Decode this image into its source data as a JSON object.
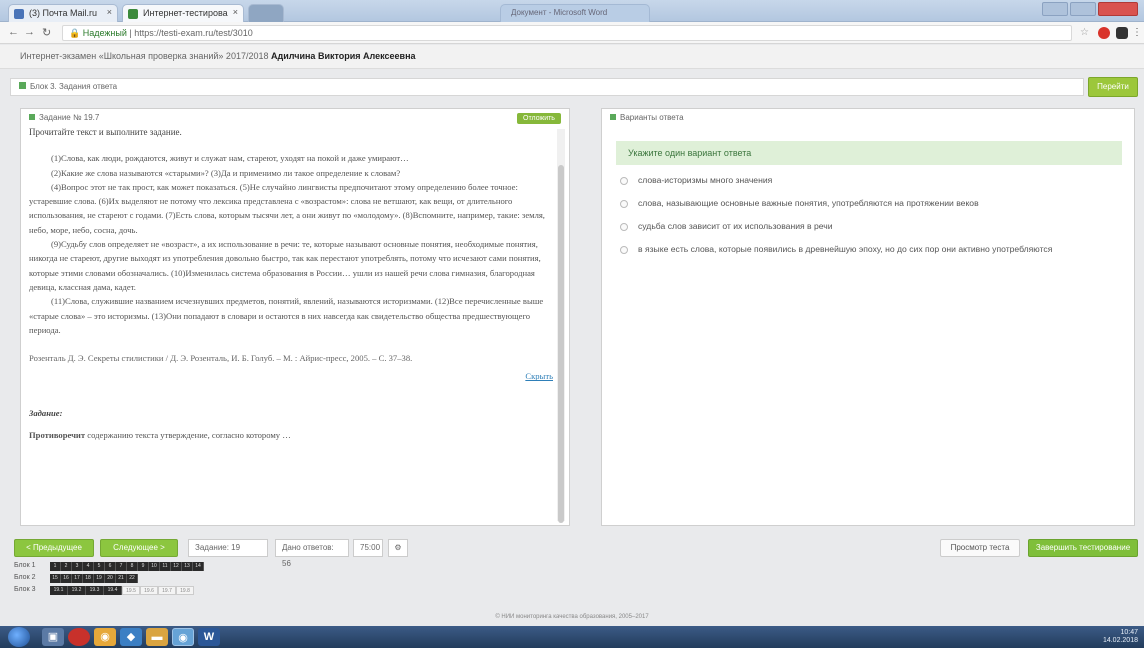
{
  "browser": {
    "tabs": [
      {
        "label": "(3) Почта Mail.ru"
      },
      {
        "label": "Интернет-тестирова"
      }
    ],
    "ghost_tab": "Документ - Microsoft Word",
    "url_secure": "Надежный",
    "url_rest": "https://testi-exam.ru/test/3010"
  },
  "title_line": {
    "prefix": "Интернет-экзамен «Школьная проверка знаний» 2017/2018",
    "name": "Адилчина Виктория Алексеевна"
  },
  "top_strip": "Блок 3. Задания ответа",
  "go_button": "Перейти",
  "left_panel": {
    "header": "Задание № 19.7",
    "tag": "Отложить",
    "intro": "Прочитайте текст и выполните задание.",
    "paragraphs": [
      "(1)Слова, как люди, рождаются, живут и служат нам, стареют, уходят на покой и даже умирают…",
      "(2)Какие же слова называются «старыми»? (3)Да и применимо ли такое определение к словам?",
      "(4)Вопрос этот не так прост, как может показаться. (5)Не случайно лингвисты предпочитают этому определению более точное: устаревшие слова. (6)Их выделяют не потому что лексика представлена с «возрастом»: слова не ветшают, как вещи, от длительного использования, не стареют с годами. (7)Есть слова, которым тысячи лет, а они живут по «молодому». (8)Вспомните, например, такие: земля, небо, море, небо, сосна, дочь.",
      "(9)Судьбу слов определяет не «возраст», а их использование в речи: те, которые называют основные понятия, необходимые понятия, никогда не стареют, другие выходят из употребления довольно быстро, так как перестают употреблять, потому что исчезают сами понятия, которые этими словами обозначались. (10)Изменилась система образования в России… ушли из нашей речи слова гимназия, благородная девица, классная дама, кадет.",
      "(11)Слова, служившие названием исчезнувших предметов, понятий, явлений, называются историзмами. (12)Все перечисленные выше «старые слова» – это историзмы. (13)Они попадают в словари и остаются в них навсегда как свидетельство общества предшествующего периода."
    ],
    "source": "Розенталь Д. Э. Секреты стилистики / Д. Э. Розенталь, И. Б. Голуб. – М. : Айрис-пресс, 2005. – С. 37–38.",
    "more_link": "Скрыть",
    "task_label": "Задание:",
    "task_bold": "Противоречит",
    "task_text": "содержанию текста утверждение, согласно которому …"
  },
  "right_panel": {
    "header": "Варианты ответа",
    "question": "Укажите один вариант ответа",
    "options": [
      "слова-историзмы много значения",
      "слова, называющие основные важные понятия, употребляются на протяжении веков",
      "судьба слов зависит от их использования в речи",
      "в языке есть слова, которые появились в древнейшую эпоху, но до сих пор они активно употребляются"
    ]
  },
  "toolbar": {
    "prev": "< Предыдущее",
    "next": "Следующее >",
    "task_label": "Задание: 19",
    "section_label": "Дано ответов: 56",
    "time_label": "75:00",
    "finish": "Просмотр теста",
    "submit": "Завершить тестирование"
  },
  "blocks": [
    {
      "label": "Блок 1",
      "cells": [
        "1",
        "2",
        "3",
        "4",
        "5",
        "6",
        "7",
        "8",
        "9",
        "10",
        "11",
        "12",
        "13",
        "14"
      ],
      "light": []
    },
    {
      "label": "Блок 2",
      "cells": [
        "15",
        "16",
        "17",
        "18",
        "19",
        "20",
        "21",
        "22"
      ],
      "light": []
    },
    {
      "label": "Блок 3",
      "cells": [
        "19.1",
        "19.2",
        "19.3",
        "19.4"
      ],
      "light": [
        "19.5",
        "19.6",
        "19.7",
        "19.8"
      ]
    }
  ],
  "footer": "© НИИ мониторинга качества образования, 2005–2017",
  "tray": {
    "time": "10:47",
    "date": "14.02.2018"
  }
}
